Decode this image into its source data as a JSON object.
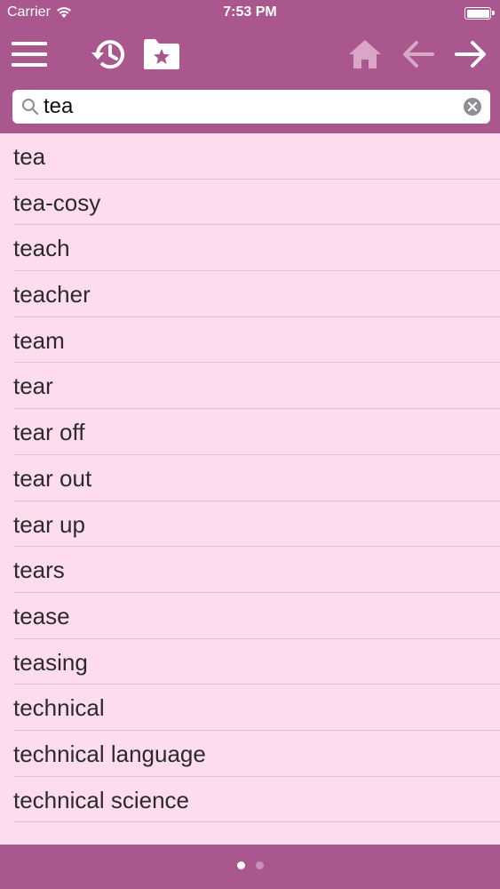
{
  "status_bar": {
    "carrier": "Carrier",
    "time": "7:53 PM"
  },
  "toolbar": {
    "menu_icon": "hamburger-menu-icon",
    "history_icon": "history-clock-icon",
    "favorites_icon": "star-folder-icon",
    "home_icon": "home-icon",
    "back_icon": "arrow-left-icon",
    "forward_icon": "arrow-right-icon"
  },
  "search": {
    "value": "tea",
    "placeholder": ""
  },
  "words": [
    "tea",
    "tea-cosy",
    "teach",
    "teacher",
    "team",
    "tear",
    "tear off",
    "tear out",
    "tear up",
    "tears",
    "tease",
    "teasing",
    "technical",
    "technical language",
    "technical science"
  ],
  "colors": {
    "bar": "#a9578c",
    "list_background": "#fddcf0",
    "separator": "#e8bfd6",
    "disabled_icon": "#d9a6c6"
  },
  "pager": {
    "count": 2,
    "active": 1
  }
}
